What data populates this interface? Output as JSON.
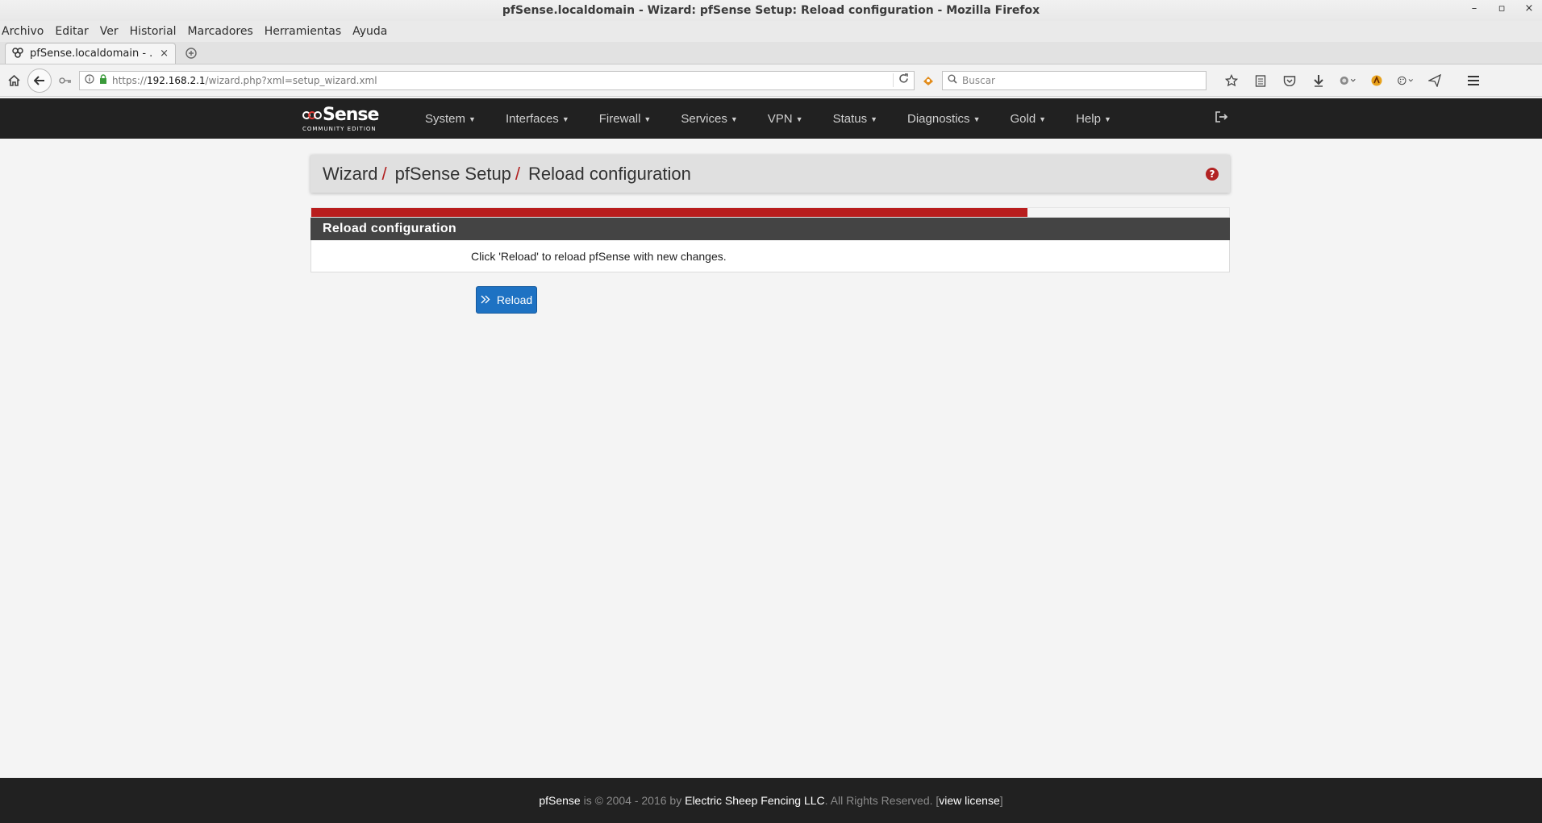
{
  "window": {
    "title": "pfSense.localdomain - Wizard: pfSense Setup: Reload configuration - Mozilla Firefox",
    "controls": [
      "–",
      "▫",
      "×"
    ]
  },
  "menubar": [
    "Archivo",
    "Editar",
    "Ver",
    "Historial",
    "Marcadores",
    "Herramientas",
    "Ayuda"
  ],
  "tab": {
    "title": "pfSense.localdomain - ...",
    "close": "×",
    "new_tab": "+"
  },
  "navbar": {
    "url_prefix": "https://",
    "url_host": "192.168.2.1",
    "url_path": "/wizard.php?xml=setup_wizard.xml",
    "search_placeholder": "Buscar"
  },
  "pfsense": {
    "logo_word": "Sense",
    "logo_sub": "COMMUNITY EDITION",
    "menu": [
      "System",
      "Interfaces",
      "Firewall",
      "Services",
      "VPN",
      "Status",
      "Diagnostics",
      "Gold",
      "Help"
    ]
  },
  "breadcrumb": [
    "Wizard",
    "pfSense Setup",
    "Reload configuration"
  ],
  "breadcrumb_sep": "/",
  "help_icon": "?",
  "progress": {
    "value_percent": 78,
    "color": "#b81d1d"
  },
  "panel": {
    "heading": "Reload configuration",
    "body": "Click 'Reload' to reload pfSense with new changes."
  },
  "button": {
    "label": "Reload",
    "color": "#1e72c3"
  },
  "footer": {
    "brand": "pfSense",
    "text1": " is © 2004 - 2016 by ",
    "company": "Electric Sheep Fencing LLC",
    "text2": ". All Rights Reserved. [",
    "license": "view license",
    "text3": "]"
  },
  "icons": {
    "home": "home-icon",
    "back": "back-arrow-icon",
    "identity": "info-icon",
    "lock": "lock-icon",
    "reload": "reload-icon",
    "search": "search-icon",
    "bookmark_star": "star-icon",
    "reading_list": "reading-list-icon",
    "pocket": "pocket-icon",
    "download": "download-icon",
    "menu": "hamburger-icon",
    "logout": "logout-icon"
  }
}
